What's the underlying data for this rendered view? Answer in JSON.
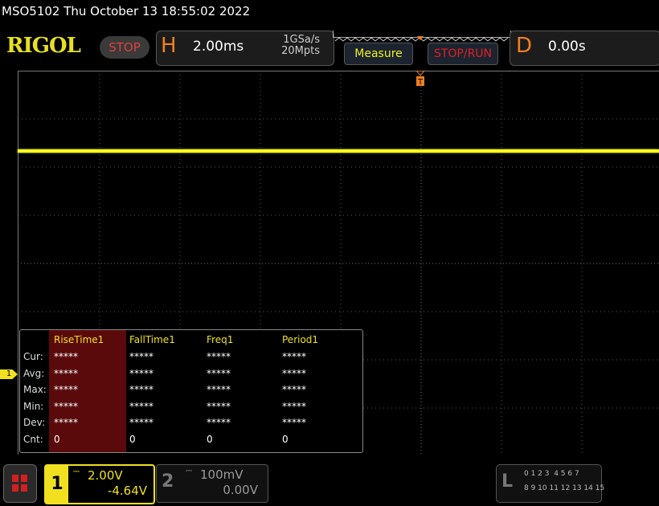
{
  "title": "MSO5102  Thu October 13 18:55:02 2022",
  "logo": "RIGOL",
  "run_state": "STOP",
  "horizontal": {
    "letter": "H",
    "timebase": "2.00ms",
    "sample_rate": "1GSa/s",
    "memory_depth": "20Mpts"
  },
  "buttons": {
    "measure": "Measure",
    "stop_run": "STOP/RUN"
  },
  "delay": {
    "letter": "D",
    "value": "0.00s"
  },
  "trigger_marker": "T",
  "channel_marker": "1",
  "measure_table": {
    "headers": [
      "RiseTime1",
      "FallTime1",
      "Freq1",
      "Period1"
    ],
    "rows": [
      {
        "label": "Cur:",
        "values": [
          "*****",
          "*****",
          "*****",
          "*****"
        ]
      },
      {
        "label": "Avg:",
        "values": [
          "*****",
          "*****",
          "*****",
          "*****"
        ]
      },
      {
        "label": "Max:",
        "values": [
          "*****",
          "*****",
          "*****",
          "*****"
        ]
      },
      {
        "label": "Min:",
        "values": [
          "*****",
          "*****",
          "*****",
          "*****"
        ]
      },
      {
        "label": "Dev:",
        "values": [
          "*****",
          "*****",
          "*****",
          "*****"
        ]
      },
      {
        "label": "Cnt:",
        "values": [
          "0",
          "0",
          "0",
          "0"
        ]
      }
    ]
  },
  "ch1": {
    "num": "1",
    "scale": "2.00V",
    "offset": "-4.64V"
  },
  "ch2": {
    "num": "2",
    "scale": "100mV",
    "offset": "0.00V"
  },
  "logic": {
    "letter": "L",
    "row1": "0 1 2 3  4 5 6 7",
    "row2": "8 9 10 11 12 13 14 15"
  },
  "colors": {
    "ch1": "#f0e020",
    "accent": "#f08020",
    "stop": "#e02020"
  }
}
